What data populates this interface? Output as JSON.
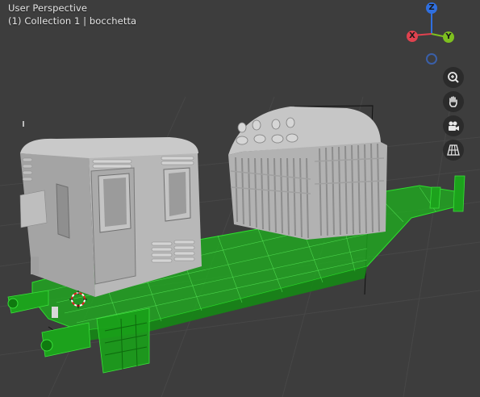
{
  "viewport": {
    "view_mode": "User Perspective",
    "view_info": "(1) Collection 1 | bocchetta"
  },
  "gizmo": {
    "axes": [
      {
        "label": "Z",
        "color": "#2f6fe0"
      },
      {
        "label": "X",
        "color": "#e0424f"
      },
      {
        "label": "Y",
        "color": "#7ec01f"
      }
    ],
    "negative_axis_color": "#3a5fa8"
  },
  "nav_tools": [
    {
      "name": "zoom",
      "icon": "zoom-icon"
    },
    {
      "name": "pan",
      "icon": "hand-icon"
    },
    {
      "name": "camera",
      "icon": "camera-icon"
    },
    {
      "name": "ortho",
      "icon": "grid-icon"
    }
  ],
  "colors": {
    "background": "#3d3d3d",
    "grid_line": "#474747",
    "chassis_selected": "#1fb41f",
    "model_gray": "#9a9a9a"
  }
}
